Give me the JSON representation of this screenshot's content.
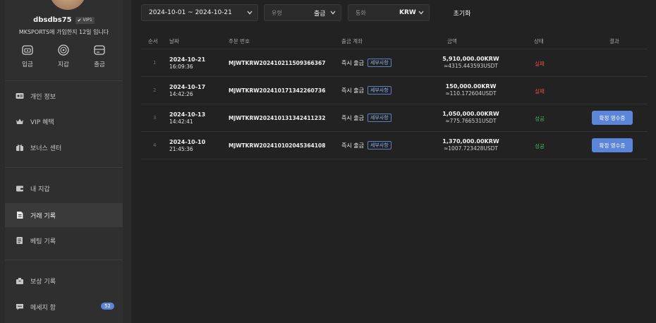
{
  "profile": {
    "username": "dbsdbs75",
    "vip": "VIP1",
    "join_text": "MKSPORTS에 가입한지 12일 입니다"
  },
  "quick_actions": [
    {
      "label": "입금",
      "icon": "deposit-wallet-icon"
    },
    {
      "label": "지갑",
      "icon": "wallet-circle-icon"
    },
    {
      "label": "출금",
      "icon": "withdraw-card-icon"
    }
  ],
  "menu": [
    {
      "label": "개인 정보",
      "icon": "id-card-icon"
    },
    {
      "label": "VIP 혜택",
      "icon": "crown-icon"
    },
    {
      "label": "보너스 센터",
      "icon": "gift-icon"
    },
    {
      "label": "내 지갑",
      "icon": "wallet-icon"
    },
    {
      "label": "거래 기록",
      "icon": "document-icon",
      "active": true
    },
    {
      "label": "베팅 기록",
      "icon": "list-document-icon"
    },
    {
      "label": "보상 기록",
      "icon": "reward-box-icon"
    },
    {
      "label": "메세지 함",
      "icon": "message-icon",
      "badge": "52"
    }
  ],
  "filters": {
    "date_range": "2024-10-01 ~ 2024-10-21",
    "type_label": "유형",
    "type_value": "출금",
    "currency_label": "통화",
    "currency_value": "KRW",
    "reset": "초기화"
  },
  "table": {
    "headers": [
      "순서",
      "날짜",
      "주문 번호",
      "출금 계좌",
      "금액",
      "상태",
      "결과"
    ],
    "rows": [
      {
        "index": "1",
        "date": "2024-10-21",
        "time": "16:09:36",
        "order": "MJWTKRW20241021150936636​7",
        "method": "즉시 출금",
        "detail": "세부사항",
        "amount": "5,910,000.00KRW",
        "usdt": "≈4315.443593USDT",
        "status": "실패",
        "status_kind": "fail",
        "result": ""
      },
      {
        "index": "2",
        "date": "2024-10-17",
        "time": "14:42:26",
        "order": "MJWTKRW202410171342260736",
        "method": "즉시 출금",
        "detail": "세부사항",
        "amount": "150,000.00KRW",
        "usdt": "≈110.172604USDT",
        "status": "실패",
        "status_kind": "fail",
        "result": ""
      },
      {
        "index": "3",
        "date": "2024-10-13",
        "time": "14:42:41",
        "order": "MJWTKRW202410131342411232",
        "method": "즉시 출금",
        "detail": "세부사항",
        "amount": "1,050,000.00KRW",
        "usdt": "≈775.766531USDT",
        "status": "성공",
        "status_kind": "ok",
        "result": "확정 영수증"
      },
      {
        "index": "4",
        "date": "2024-10-10",
        "time": "21:45:36",
        "order": "MJWTKRW202410102045364108",
        "method": "즉시 출금",
        "detail": "세부사항",
        "amount": "1,370,000.00KRW",
        "usdt": "≈1007.723428USDT",
        "status": "성공",
        "status_kind": "ok",
        "result": "확정 영수증"
      }
    ]
  },
  "colors": {
    "accent": "#5b85d8",
    "fail": "#e04b4b",
    "success": "#3fb56b"
  }
}
